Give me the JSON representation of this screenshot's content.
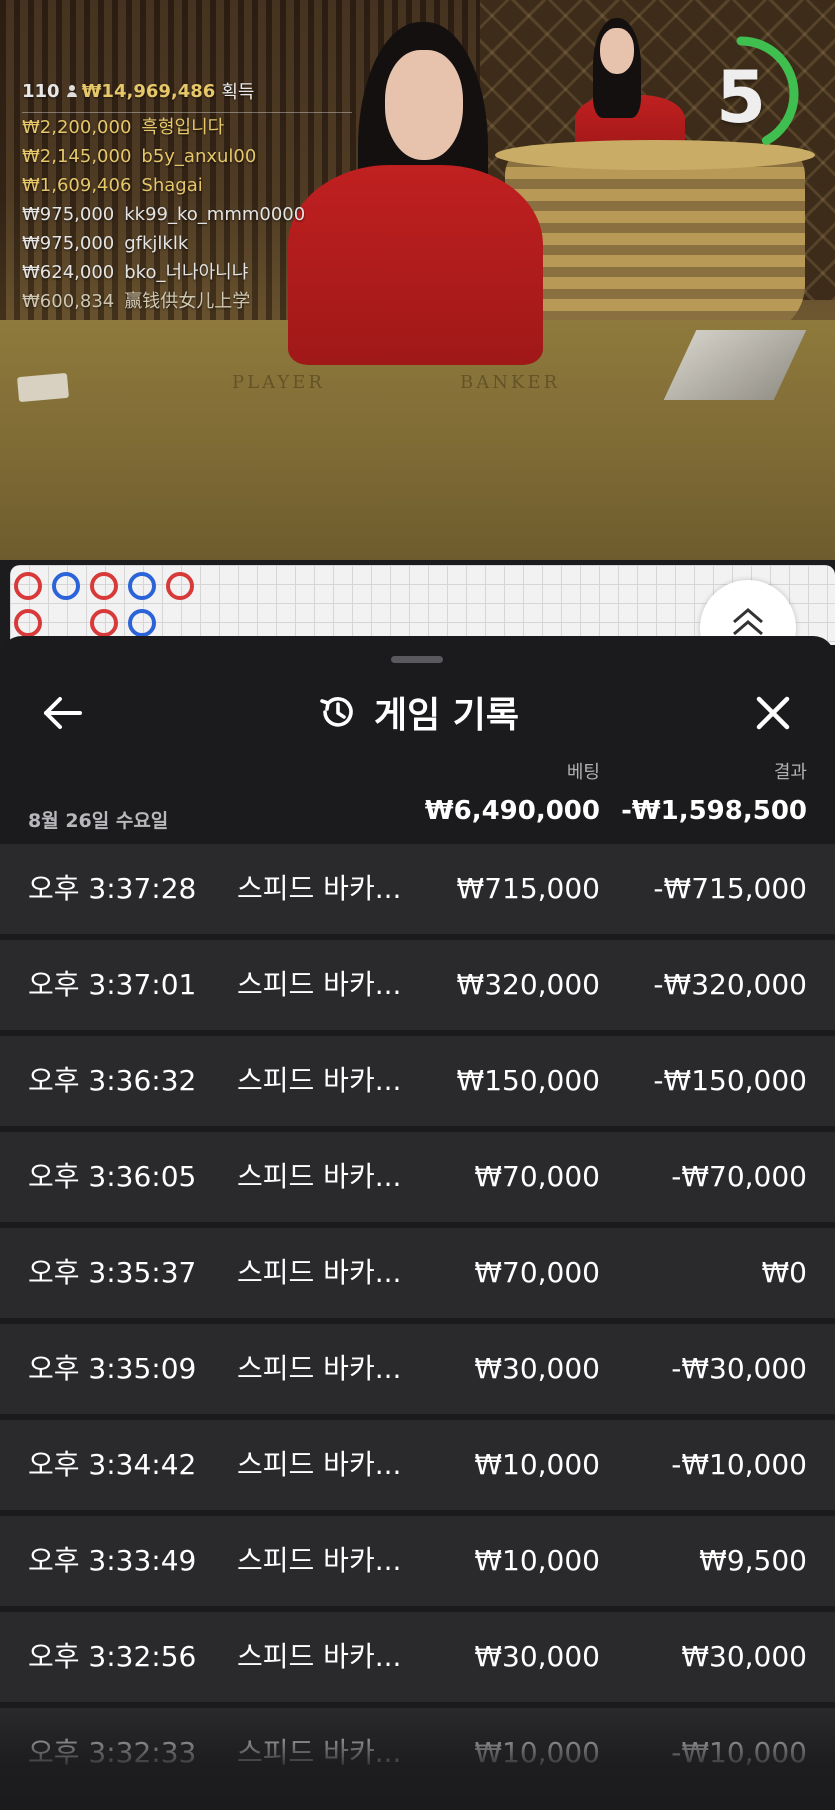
{
  "stream": {
    "table_labels": [
      "PLAYER",
      "BANKER"
    ]
  },
  "leaderboard": {
    "players_count": "110",
    "total_won": "₩14,969,486",
    "won_label": "획득",
    "entries": [
      {
        "amount": "₩2,200,000",
        "name": "흑형입니다",
        "color": "#e6c76a"
      },
      {
        "amount": "₩2,145,000",
        "name": "b5y_anxul00",
        "color": "#e6c76a"
      },
      {
        "amount": "₩1,609,406",
        "name": "Shagai",
        "color": "#e6c76a"
      },
      {
        "amount": "₩975,000",
        "name": "kk99_ko_mmm0000",
        "color": "#e4e4e4"
      },
      {
        "amount": "₩975,000",
        "name": "gfkjlklk",
        "color": "#e4e4e4"
      },
      {
        "amount": "₩624,000",
        "name": "bko_너나아니냐",
        "color": "#e4e4e4"
      },
      {
        "amount": "₩600,834",
        "name": "赢钱供女儿上学",
        "color": "#cfc6b0"
      }
    ]
  },
  "countdown": {
    "value": "5",
    "progress": 0.42,
    "color": "#3fbf4f"
  },
  "history": {
    "title": "게임 기록",
    "columns": {
      "bet": "베팅",
      "result": "결과"
    },
    "date": "8월 26일 수요일",
    "total_bet": "₩6,490,000",
    "total_result": "-₩1,598,500",
    "rows": [
      {
        "time": "오후 3:37:28",
        "game": "스피드 바카...",
        "bet": "₩715,000",
        "result": "-₩715,000"
      },
      {
        "time": "오후 3:37:01",
        "game": "스피드 바카...",
        "bet": "₩320,000",
        "result": "-₩320,000"
      },
      {
        "time": "오후 3:36:32",
        "game": "스피드 바카...",
        "bet": "₩150,000",
        "result": "-₩150,000"
      },
      {
        "time": "오후 3:36:05",
        "game": "스피드 바카...",
        "bet": "₩70,000",
        "result": "-₩70,000"
      },
      {
        "time": "오후 3:35:37",
        "game": "스피드 바카...",
        "bet": "₩70,000",
        "result": "₩0"
      },
      {
        "time": "오후 3:35:09",
        "game": "스피드 바카...",
        "bet": "₩30,000",
        "result": "-₩30,000"
      },
      {
        "time": "오후 3:34:42",
        "game": "스피드 바카...",
        "bet": "₩10,000",
        "result": "-₩10,000"
      },
      {
        "time": "오후 3:33:49",
        "game": "스피드 바카...",
        "bet": "₩10,000",
        "result": "₩9,500"
      },
      {
        "time": "오후 3:32:56",
        "game": "스피드 바카...",
        "bet": "₩30,000",
        "result": "₩30,000"
      },
      {
        "time": "오후 3:32:33",
        "game": "스피드 바카...",
        "bet": "₩10,000",
        "result": "-₩10,000"
      }
    ]
  }
}
